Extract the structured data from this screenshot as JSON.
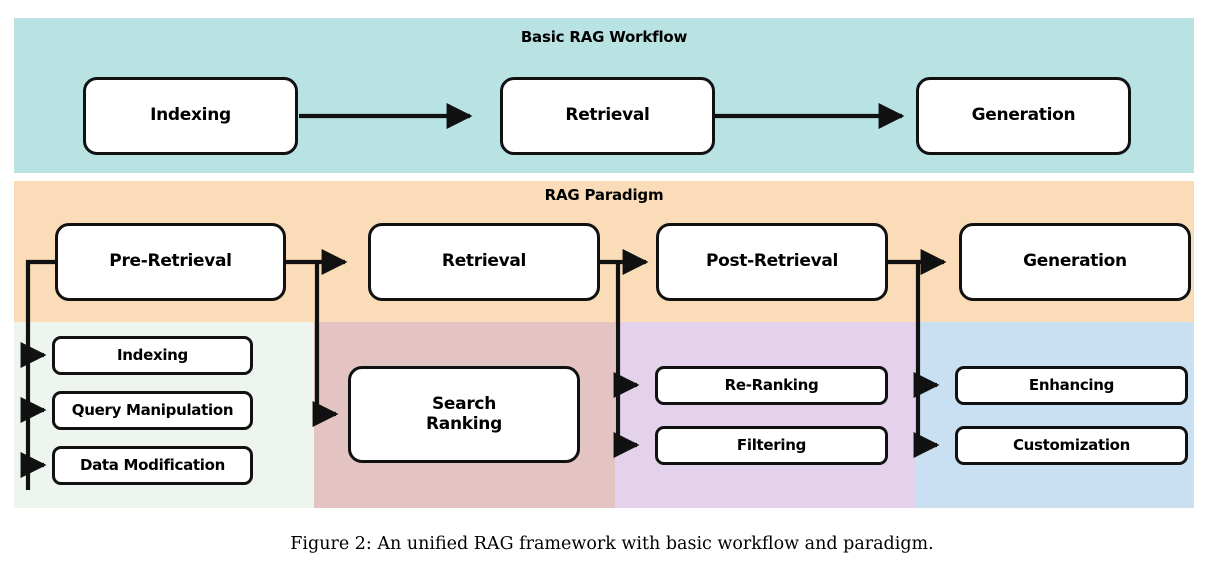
{
  "figure": {
    "caption": "Figure 2: An unified RAG framework with basic workflow and paradigm."
  },
  "sections": [
    {
      "id": "basic-rag-workflow",
      "title": "Basic RAG Workflow",
      "color": "#b9e3e3"
    },
    {
      "id": "rag-paradigm",
      "title": "RAG Paradigm",
      "color": "#fadcb8"
    }
  ],
  "swimlanes": [
    {
      "id": "pre-retrieval-lane",
      "color": "#eef5ee"
    },
    {
      "id": "retrieval-lane",
      "color": "#e3c4c2"
    },
    {
      "id": "post-retrieval-lane",
      "color": "#e4d2ec"
    },
    {
      "id": "generation-lane",
      "color": "#c8e0f2"
    }
  ],
  "workflow": {
    "nodes": [
      {
        "id": "wf-indexing",
        "label": "Indexing"
      },
      {
        "id": "wf-retrieval",
        "label": "Retrieval"
      },
      {
        "id": "wf-generation",
        "label": "Generation"
      }
    ]
  },
  "paradigm": {
    "stages": [
      {
        "id": "pre-retrieval",
        "label": "Pre-Retrieval"
      },
      {
        "id": "retrieval",
        "label": "Retrieval"
      },
      {
        "id": "post-retrieval",
        "label": "Post-Retrieval"
      },
      {
        "id": "generation",
        "label": "Generation"
      }
    ],
    "substeps": {
      "pre_retrieval": [
        {
          "id": "indexing",
          "label": "Indexing"
        },
        {
          "id": "query-manipulation",
          "label": "Query Manipulation"
        },
        {
          "id": "data-modification",
          "label": "Data Modification"
        }
      ],
      "retrieval": [
        {
          "id": "search-ranking",
          "label": "Search\nRanking"
        }
      ],
      "post_retrieval": [
        {
          "id": "re-ranking",
          "label": "Re-Ranking"
        },
        {
          "id": "filtering",
          "label": "Filtering"
        }
      ],
      "generation": [
        {
          "id": "enhancing",
          "label": "Enhancing"
        },
        {
          "id": "customization",
          "label": "Customization"
        }
      ]
    }
  },
  "style": {
    "stroke": "#111111",
    "node_fill": "#ffffff"
  }
}
